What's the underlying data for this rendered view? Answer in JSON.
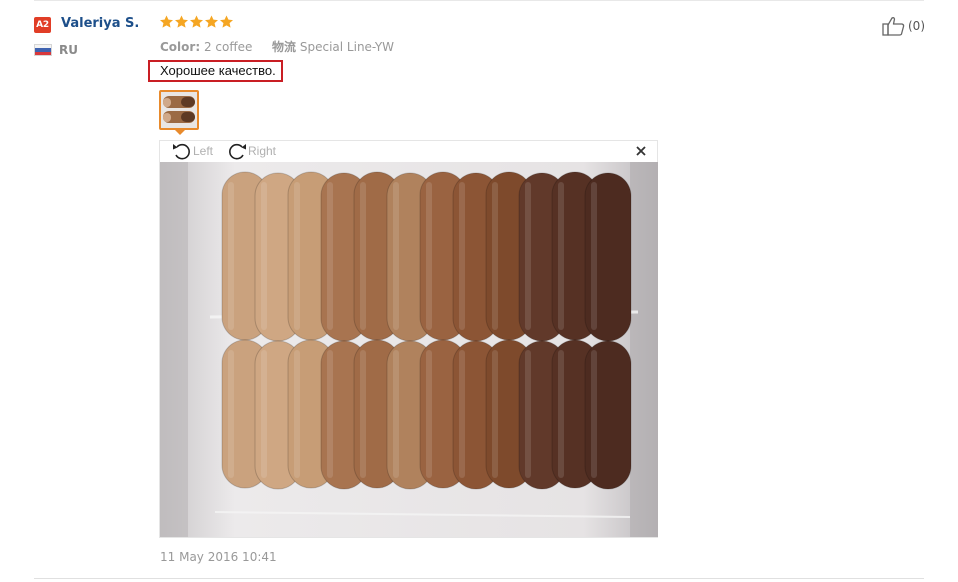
{
  "review": {
    "user": {
      "level_badge": "A2",
      "name": "Valeriya S.",
      "country": "RU"
    },
    "rating": 5,
    "attributes": [
      {
        "name": "Color:",
        "value": "2 coffee"
      },
      {
        "name": "物流",
        "value": "Special Line-YW"
      }
    ],
    "text": "Хорошее качество.",
    "image_viewer": {
      "rotate_left_label": "Left",
      "rotate_right_label": "Right"
    },
    "date": "11 May 2016 10:41",
    "helpful_count": "(0)"
  },
  "colors": {
    "user_name": "#1d4f8a",
    "badge": "#e13d26",
    "stars": "#f5a623",
    "highlight_border": "#c91e24",
    "thumb_border": "#e88a2c"
  },
  "icons": {
    "badge": "level-badge",
    "flag": "russia-flag-icon",
    "star": "star-icon",
    "rotate_left": "rotate-left-icon",
    "rotate_right": "rotate-right-icon",
    "close": "close-icon",
    "like": "thumbs-up-icon"
  }
}
